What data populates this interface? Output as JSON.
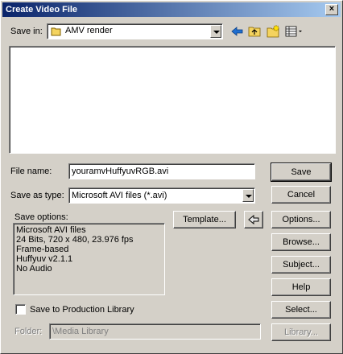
{
  "window": {
    "title": "Create Video File",
    "close_glyph": "×"
  },
  "save_in": {
    "label": "Save in:",
    "value": "AMV render"
  },
  "file_name": {
    "label": "File name:",
    "value": "youramvHuffyuvRGB.avi"
  },
  "save_as_type": {
    "label": "Save as type:",
    "value": "Microsoft AVI files (*.avi)"
  },
  "save_options": {
    "label": "Save options:",
    "lines": [
      "Microsoft AVI files",
      "24 Bits, 720 x 480, 23.976 fps",
      "Frame-based",
      "Huffyuv v2.1.1",
      "No Audio"
    ]
  },
  "buttons": {
    "save": "Save",
    "cancel": "Cancel",
    "template": "Template...",
    "options": "Options...",
    "browse": "Browse...",
    "subject": "Subject...",
    "help": "Help",
    "select": "Select...",
    "library": "Library..."
  },
  "production_library": {
    "label": "Save to Production Library",
    "checked": false
  },
  "folder": {
    "label": "Folder:",
    "value": "\\Media Library"
  },
  "colors": {
    "title_start": "#0a246a",
    "title_end": "#a6caf0",
    "face": "#d4d0c8"
  }
}
